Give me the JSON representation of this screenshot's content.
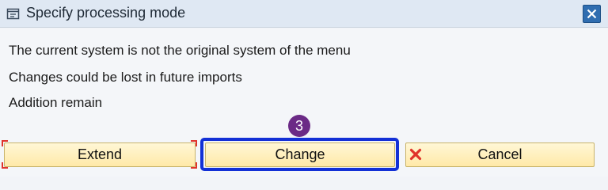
{
  "dialog": {
    "title": "Specify processing mode",
    "close_icon": "close-icon",
    "title_icon": "edit-window-icon"
  },
  "messages": [
    "The current system is not the original system of the menu",
    "Changes could be lost in future imports",
    "Addition remain"
  ],
  "buttons": {
    "extend": "Extend",
    "change": "Change",
    "cancel": "Cancel"
  },
  "annotation": {
    "step_number": "3",
    "highlight_color": "#1330d6",
    "badge_color": "#6b2a86"
  },
  "colors": {
    "titlebar": "#dfe8f3",
    "button_fill": "#ffe9a8",
    "cancel_icon": "#e0332b",
    "close_button": "#2f6db0"
  }
}
